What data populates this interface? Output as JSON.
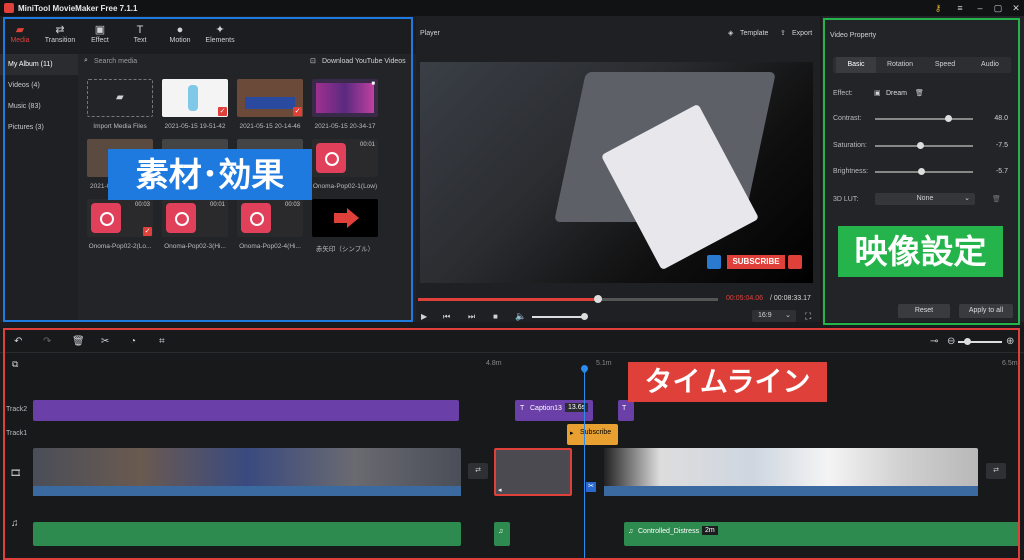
{
  "app": {
    "title": "MiniTool MovieMaker Free 7.1.1"
  },
  "media_tabs": [
    {
      "label": "Media",
      "icon": "folder-icon"
    },
    {
      "label": "Transition",
      "icon": "transition-icon"
    },
    {
      "label": "Effect",
      "icon": "effect-icon"
    },
    {
      "label": "Text",
      "icon": "text-icon"
    },
    {
      "label": "Motion",
      "icon": "motion-icon"
    },
    {
      "label": "Elements",
      "icon": "elements-icon"
    }
  ],
  "albums": [
    "My Album (11)",
    "Videos (4)",
    "Music (83)",
    "Pictures (3)"
  ],
  "search": {
    "placeholder": "Search media",
    "download": "Download YouTube Videos"
  },
  "media_items": [
    {
      "label": "Import Media Files",
      "type": "import"
    },
    {
      "label": "2021-05-15 19-51-42",
      "type": "image"
    },
    {
      "label": "2021-05-15 20-14-46",
      "type": "video"
    },
    {
      "label": "2021-05-15 20-34-17",
      "type": "video"
    },
    {
      "label": "2021-0",
      "type": "video"
    },
    {
      "label": "",
      "type": "video"
    },
    {
      "label": "",
      "type": "video"
    },
    {
      "label": "Onoma-Pop02-1(Low)",
      "type": "music",
      "duration": "00:01"
    },
    {
      "label": "Onoma-Pop02-2(Lo...",
      "type": "music",
      "duration": "00:03"
    },
    {
      "label": "Onoma-Pop02-3(Hi...",
      "type": "music",
      "duration": "00:01"
    },
    {
      "label": "Onoma-Pop02-4(Hi...",
      "type": "music",
      "duration": "00:03"
    },
    {
      "label": "赤矢印（シンプル）",
      "type": "arrow"
    }
  ],
  "callouts": {
    "media": "素材･効果",
    "props": "映像設定",
    "timeline": "タイムライン"
  },
  "player": {
    "label": "Player",
    "template": "Template",
    "export": "Export",
    "time_current": "00:05:04.06",
    "time_total": "/ 00:08:33.17",
    "progress": 0.6,
    "aspect": "16:9",
    "subscribe": "SUBSCRIBE"
  },
  "props": {
    "title": "Video Property",
    "tabs": [
      "Basic",
      "Rotation",
      "Speed",
      "Audio"
    ],
    "effect_label": "Effect:",
    "effect_value": "Dream",
    "rows": [
      {
        "label": "Contrast:",
        "value": "48.0",
        "pos": 0.74
      },
      {
        "label": "Saturation:",
        "value": "-7.5",
        "pos": 0.46
      },
      {
        "label": "Brightness:",
        "value": "-5.7",
        "pos": 0.47
      }
    ],
    "lut_label": "3D LUT:",
    "lut_value": "None",
    "reset": "Reset",
    "apply": "Apply to all"
  },
  "timeline": {
    "ruler": [
      "4.8m",
      "5.1m",
      "6.5m"
    ],
    "tracks": [
      "Track2",
      "Track1"
    ],
    "caption": "Caption13",
    "caption_dur": "13.6s",
    "subscribe": "Subscribe",
    "audio": "Controlled_Distress",
    "audio_dur": "2m"
  },
  "colors": {
    "accent": "#e0403a",
    "blue": "#1f7ae0",
    "green": "#25b34b",
    "purple": "#6a3fa8",
    "audio": "#2e8b4f"
  }
}
